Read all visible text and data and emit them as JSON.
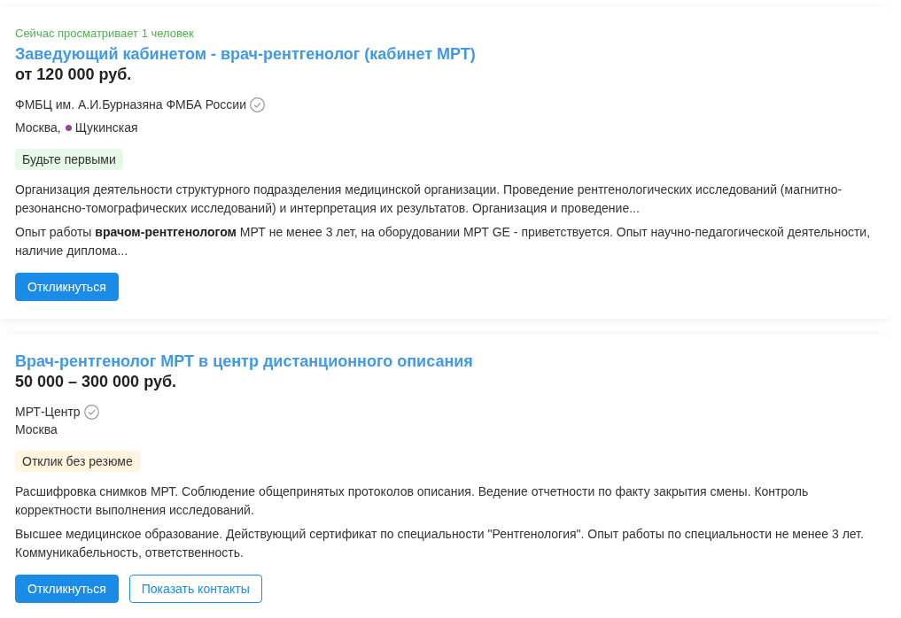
{
  "vacancies": [
    {
      "viewers_note": "Сейчас просматривает 1 человек",
      "title": "Заведующий кабинетом - врач-рентгенолог (кабинет МРТ)",
      "salary": "от 120 000 руб.",
      "company": {
        "name": "ФМБЦ им. А.И.Бурназяна ФМБА России",
        "verified": true
      },
      "location": {
        "city": "Москва,",
        "metro": {
          "station": "Щукинская",
          "color": "#94489a"
        }
      },
      "tag": {
        "text": "Будьте первыми",
        "kind": "success"
      },
      "description": "Организация деятельности структурного подразделения медицинской организации. Проведение рентгенологических исследований (магнитно-резонансно-томографических исследований) и интерпретация их результатов. Организация и проведение...",
      "requirements": "Опыт работы **врачом-рентгенологом** МРТ не менее 3 лет, на оборудовании МРТ GE - приветствуется. Опыт научно-педагогической деятельности, наличие диплома...",
      "actions": [
        {
          "label": "Откликнуться",
          "kind": "primary"
        }
      ]
    },
    {
      "title": "Врач-рентгенолог МРТ в центр дистанционного описания",
      "salary": "50 000 – 300 000 руб.",
      "company": {
        "name": "МРТ-Центр",
        "verified": true
      },
      "location": {
        "city": "Москва"
      },
      "tag": {
        "text": "Отклик без резюме",
        "kind": "warning"
      },
      "description": "Расшифровка снимков МРТ. Соблюдение общепринятых протоколов описания. Ведение отчетности по факту закрытия смены. Контроль корректности выполнения исследований.",
      "requirements": "Высшее медицинское образование. Действующий сертификат по специальности \"Рентгенология\". Опыт работы по специальности не менее 3 лет. Коммуникабельность, ответственность.",
      "actions": [
        {
          "label": "Откликнуться",
          "kind": "primary"
        },
        {
          "label": "Показать контакты",
          "kind": "outline"
        }
      ]
    }
  ]
}
